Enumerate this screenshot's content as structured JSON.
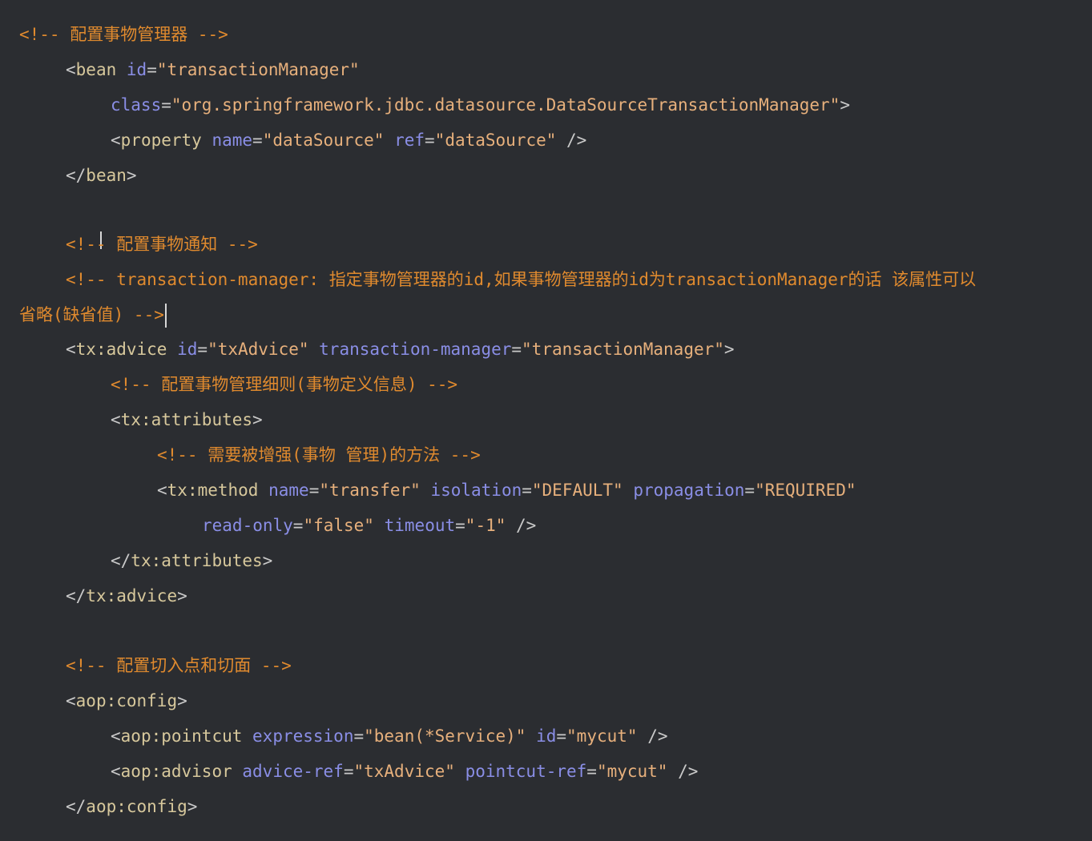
{
  "theme": {
    "background": "#2b2d31",
    "comment": "#e08a2e",
    "punct": "#c9c9c9",
    "tag": "#d7c89c",
    "attr": "#8a8ee6",
    "value": "#e7b07c",
    "plain": "#cfcfcf"
  },
  "lines": [
    {
      "tokens": [
        {
          "t": "<!-- 配置事物管理器 -->",
          "k": "comment"
        }
      ]
    },
    {
      "tokens": [
        {
          "t": "<",
          "k": "punct"
        },
        {
          "t": "bean",
          "k": "tag"
        },
        {
          "t": " ",
          "k": "plain"
        },
        {
          "t": "id",
          "k": "attr"
        },
        {
          "t": "=",
          "k": "punct"
        },
        {
          "t": "\"transactionManager\"",
          "k": "value"
        }
      ]
    },
    {
      "tokens": [
        {
          "t": "class",
          "k": "attr"
        },
        {
          "t": "=",
          "k": "punct"
        },
        {
          "t": "\"org.springframework.jdbc.datasource.DataSourceTransactionManager\"",
          "k": "value"
        },
        {
          "t": ">",
          "k": "punct"
        }
      ]
    },
    {
      "tokens": [
        {
          "t": "<",
          "k": "punct"
        },
        {
          "t": "property",
          "k": "tag"
        },
        {
          "t": " ",
          "k": "plain"
        },
        {
          "t": "name",
          "k": "attr"
        },
        {
          "t": "=",
          "k": "punct"
        },
        {
          "t": "\"dataSource\"",
          "k": "value"
        },
        {
          "t": " ",
          "k": "plain"
        },
        {
          "t": "ref",
          "k": "attr"
        },
        {
          "t": "=",
          "k": "punct"
        },
        {
          "t": "\"dataSource\"",
          "k": "value"
        },
        {
          "t": " />",
          "k": "punct"
        }
      ]
    },
    {
      "tokens": [
        {
          "t": "</",
          "k": "punct"
        },
        {
          "t": "bean",
          "k": "tag"
        },
        {
          "t": ">",
          "k": "punct"
        }
      ]
    },
    {
      "tokens": [
        {
          "t": "<!-- 配置事物通知 -->",
          "k": "comment"
        }
      ]
    },
    {
      "tokens": [
        {
          "t": "<!-- transaction-manager: 指定事物管理器的id,如果事物管理器的id为transactionManager的话 该属性可以",
          "k": "comment"
        }
      ]
    },
    {
      "tokens": [
        {
          "t": "省略(缺省值) -->",
          "k": "comment"
        }
      ]
    },
    {
      "tokens": [
        {
          "t": "<",
          "k": "punct"
        },
        {
          "t": "tx:advice",
          "k": "tag"
        },
        {
          "t": " ",
          "k": "plain"
        },
        {
          "t": "id",
          "k": "attr"
        },
        {
          "t": "=",
          "k": "punct"
        },
        {
          "t": "\"txAdvice\"",
          "k": "value"
        },
        {
          "t": " ",
          "k": "plain"
        },
        {
          "t": "transaction-manager",
          "k": "attr"
        },
        {
          "t": "=",
          "k": "punct"
        },
        {
          "t": "\"transactionManager\"",
          "k": "value"
        },
        {
          "t": ">",
          "k": "punct"
        }
      ]
    },
    {
      "tokens": [
        {
          "t": "<!-- 配置事物管理细则(事物定义信息) -->",
          "k": "comment"
        }
      ]
    },
    {
      "tokens": [
        {
          "t": "<",
          "k": "punct"
        },
        {
          "t": "tx:attributes",
          "k": "tag"
        },
        {
          "t": ">",
          "k": "punct"
        }
      ]
    },
    {
      "tokens": [
        {
          "t": "<!-- 需要被增强(事物 管理)的方法 -->",
          "k": "comment"
        }
      ]
    },
    {
      "tokens": [
        {
          "t": "<",
          "k": "punct"
        },
        {
          "t": "tx:method",
          "k": "tag"
        },
        {
          "t": " ",
          "k": "plain"
        },
        {
          "t": "name",
          "k": "attr"
        },
        {
          "t": "=",
          "k": "punct"
        },
        {
          "t": "\"transfer\"",
          "k": "value"
        },
        {
          "t": " ",
          "k": "plain"
        },
        {
          "t": "isolation",
          "k": "attr"
        },
        {
          "t": "=",
          "k": "punct"
        },
        {
          "t": "\"DEFAULT\"",
          "k": "value"
        },
        {
          "t": " ",
          "k": "plain"
        },
        {
          "t": "propagation",
          "k": "attr"
        },
        {
          "t": "=",
          "k": "punct"
        },
        {
          "t": "\"REQUIRED\"",
          "k": "value"
        }
      ]
    },
    {
      "tokens": [
        {
          "t": "read-only",
          "k": "attr"
        },
        {
          "t": "=",
          "k": "punct"
        },
        {
          "t": "\"false\"",
          "k": "value"
        },
        {
          "t": " ",
          "k": "plain"
        },
        {
          "t": "timeout",
          "k": "attr"
        },
        {
          "t": "=",
          "k": "punct"
        },
        {
          "t": "\"-1\"",
          "k": "value"
        },
        {
          "t": " />",
          "k": "punct"
        }
      ]
    },
    {
      "tokens": [
        {
          "t": "</",
          "k": "punct"
        },
        {
          "t": "tx:attributes",
          "k": "tag"
        },
        {
          "t": ">",
          "k": "punct"
        }
      ]
    },
    {
      "tokens": [
        {
          "t": "</",
          "k": "punct"
        },
        {
          "t": "tx:advice",
          "k": "tag"
        },
        {
          "t": ">",
          "k": "punct"
        }
      ]
    },
    {
      "tokens": [
        {
          "t": "<!-- 配置切入点和切面 -->",
          "k": "comment"
        }
      ]
    },
    {
      "tokens": [
        {
          "t": "<",
          "k": "punct"
        },
        {
          "t": "aop:config",
          "k": "tag"
        },
        {
          "t": ">",
          "k": "punct"
        }
      ]
    },
    {
      "tokens": [
        {
          "t": "<",
          "k": "punct"
        },
        {
          "t": "aop:pointcut",
          "k": "tag"
        },
        {
          "t": " ",
          "k": "plain"
        },
        {
          "t": "expression",
          "k": "attr"
        },
        {
          "t": "=",
          "k": "punct"
        },
        {
          "t": "\"bean(*Service)\"",
          "k": "value"
        },
        {
          "t": " ",
          "k": "plain"
        },
        {
          "t": "id",
          "k": "attr"
        },
        {
          "t": "=",
          "k": "punct"
        },
        {
          "t": "\"mycut\"",
          "k": "value"
        },
        {
          "t": " />",
          "k": "punct"
        }
      ]
    },
    {
      "tokens": [
        {
          "t": "<",
          "k": "punct"
        },
        {
          "t": "aop:advisor",
          "k": "tag"
        },
        {
          "t": " ",
          "k": "plain"
        },
        {
          "t": "advice-ref",
          "k": "attr"
        },
        {
          "t": "=",
          "k": "punct"
        },
        {
          "t": "\"txAdvice\"",
          "k": "value"
        },
        {
          "t": " ",
          "k": "plain"
        },
        {
          "t": "pointcut-ref",
          "k": "attr"
        },
        {
          "t": "=",
          "k": "punct"
        },
        {
          "t": "\"mycut\"",
          "k": "value"
        },
        {
          "t": " />",
          "k": "punct"
        }
      ]
    },
    {
      "tokens": [
        {
          "t": "</",
          "k": "punct"
        },
        {
          "t": "aop:config",
          "k": "tag"
        },
        {
          "t": ">",
          "k": "punct"
        }
      ]
    }
  ]
}
